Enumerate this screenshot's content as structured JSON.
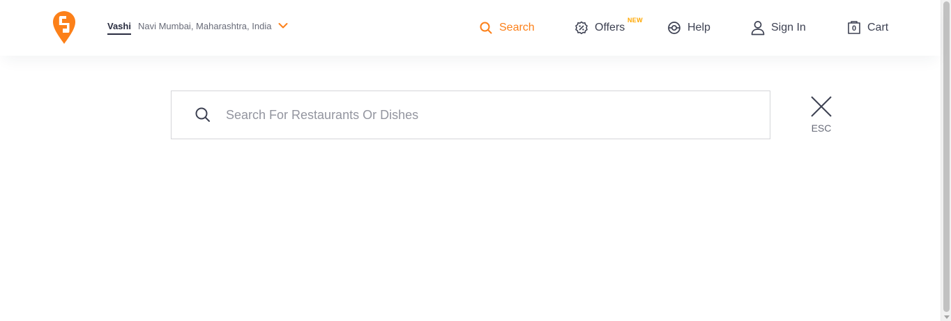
{
  "brand": {
    "accent": "#fc8019",
    "badge_color": "#ffa700"
  },
  "location": {
    "name": "Vashi",
    "detail": "Navi Mumbai, Maharashtra, India"
  },
  "nav": {
    "search_label": "Search",
    "offers_label": "Offers",
    "offers_badge": "NEW",
    "help_label": "Help",
    "signin_label": "Sign In",
    "cart_label": "Cart",
    "cart_count": "0"
  },
  "search": {
    "placeholder": "Search For Restaurants Or Dishes",
    "value": ""
  },
  "close": {
    "label": "ESC"
  },
  "icons": {
    "logo": "swiggy-logo",
    "location_chevron": "chevron-down-icon",
    "search": "search-icon",
    "offers": "discount-badge-icon",
    "help": "lifebuoy-icon",
    "signin": "user-icon",
    "cart": "bag-icon",
    "close": "close-icon"
  }
}
